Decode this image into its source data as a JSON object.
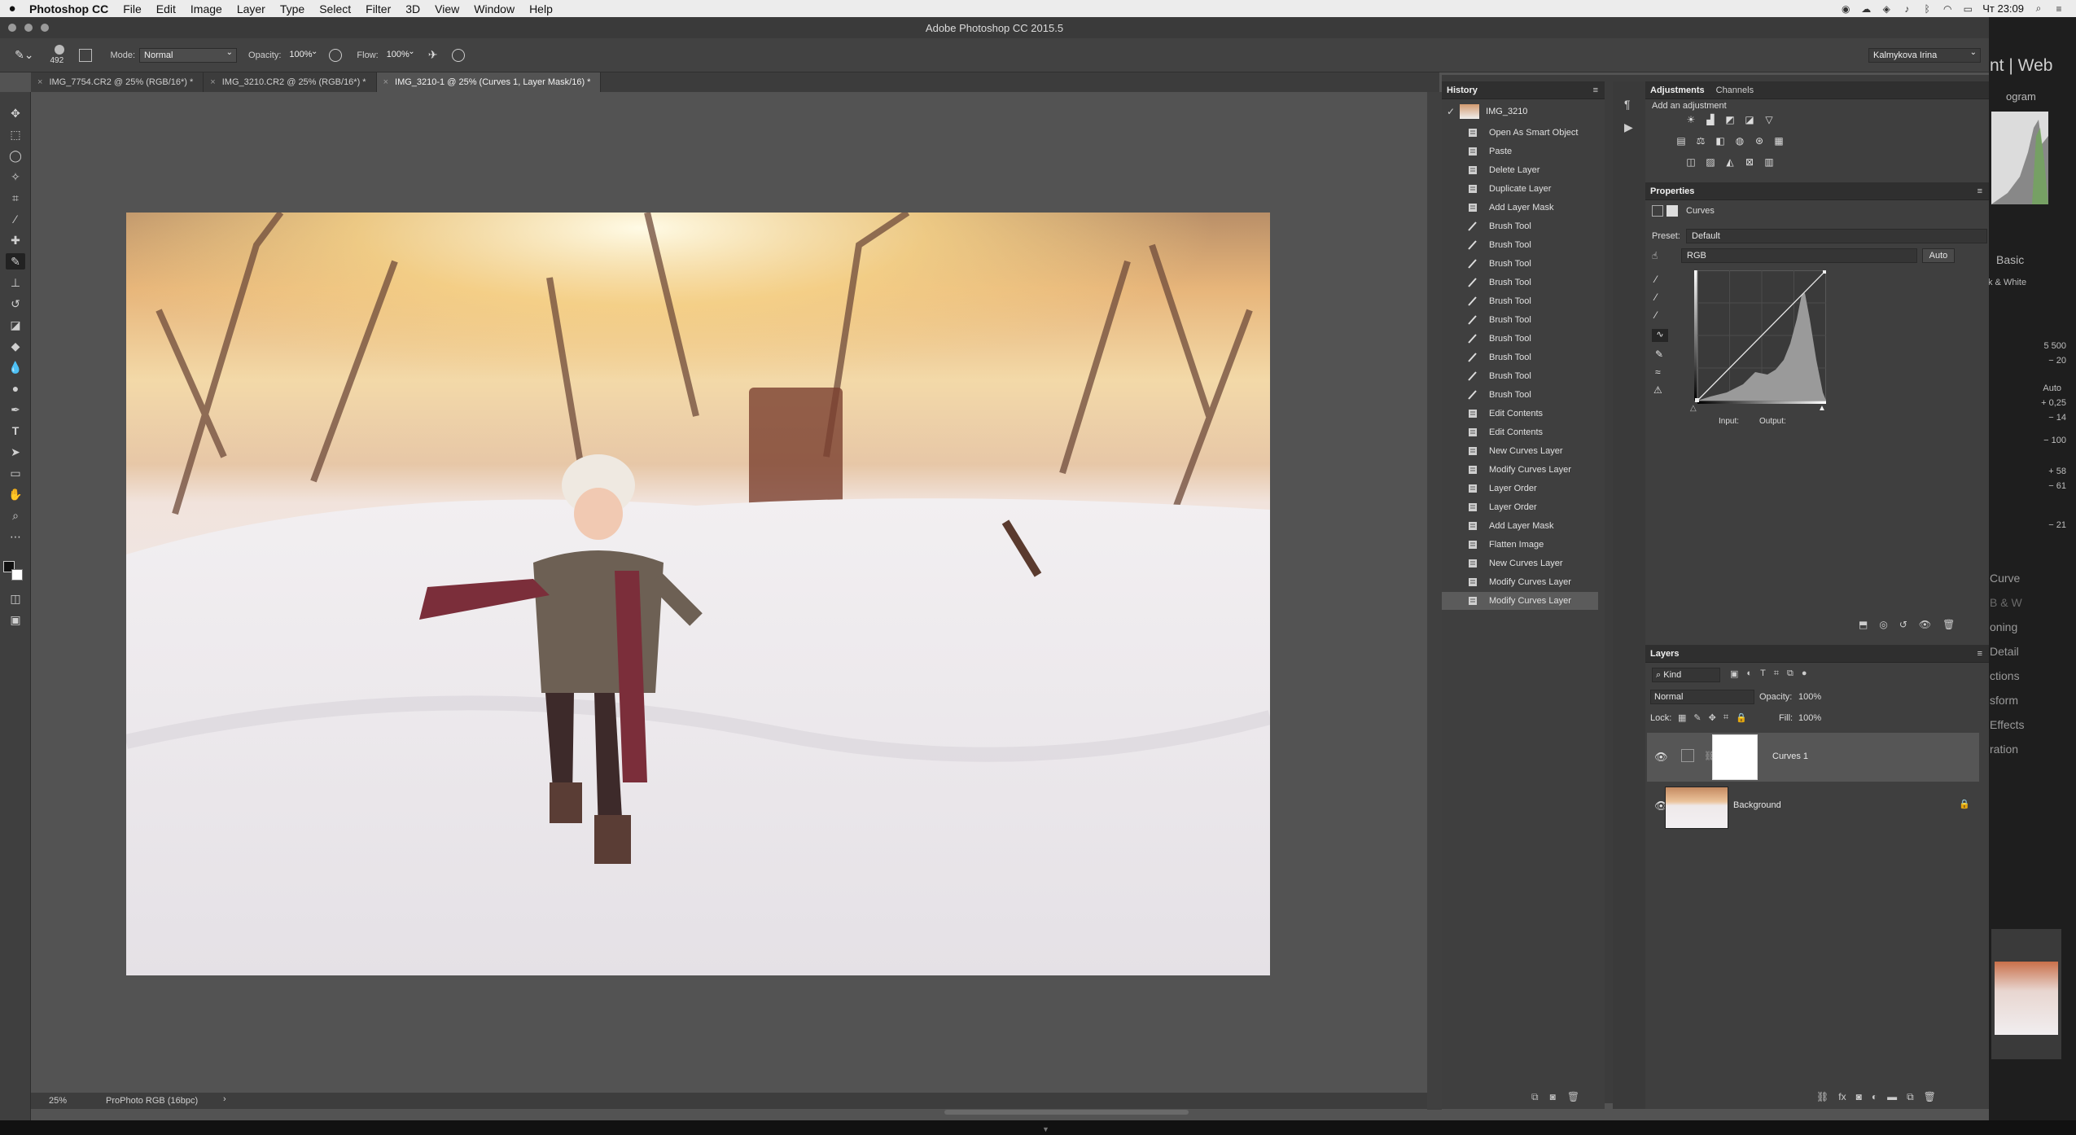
{
  "menubar": {
    "items": [
      "Photoshop CC",
      "File",
      "Edit",
      "Image",
      "Layer",
      "Type",
      "Select",
      "Filter",
      "3D",
      "View",
      "Window",
      "Help"
    ],
    "clock": "Чт 23:09"
  },
  "window": {
    "title": "Adobe Photoshop CC 2015.5"
  },
  "options": {
    "brush_size": "492",
    "mode_label": "Mode:",
    "mode_value": "Normal",
    "opacity_label": "Opacity:",
    "opacity_value": "100%",
    "flow_label": "Flow:",
    "flow_value": "100%",
    "workspace": "Kalmykova Irina"
  },
  "tabs": [
    {
      "label": "IMG_7754.CR2 @ 25% (RGB/16*) *",
      "active": false
    },
    {
      "label": "IMG_3210.CR2 @ 25% (RGB/16*) *",
      "active": false
    },
    {
      "label": "IMG_3210-1 @ 25% (Curves 1, Layer Mask/16) *",
      "active": true
    }
  ],
  "status": {
    "zoom": "25%",
    "profile": "ProPhoto RGB (16bpc)"
  },
  "history": {
    "title": "History",
    "snapshot": "IMG_3210",
    "items": [
      {
        "label": "Open As Smart Object",
        "icon": "doc-icon"
      },
      {
        "label": "Paste",
        "icon": "doc-icon"
      },
      {
        "label": "Delete Layer",
        "icon": "doc-icon"
      },
      {
        "label": "Duplicate Layer",
        "icon": "doc-icon"
      },
      {
        "label": "Add Layer Mask",
        "icon": "doc-icon"
      },
      {
        "label": "Brush Tool",
        "icon": "brush-icon"
      },
      {
        "label": "Brush Tool",
        "icon": "brush-icon"
      },
      {
        "label": "Brush Tool",
        "icon": "brush-icon"
      },
      {
        "label": "Brush Tool",
        "icon": "brush-icon"
      },
      {
        "label": "Brush Tool",
        "icon": "brush-icon"
      },
      {
        "label": "Brush Tool",
        "icon": "brush-icon"
      },
      {
        "label": "Brush Tool",
        "icon": "brush-icon"
      },
      {
        "label": "Brush Tool",
        "icon": "brush-icon"
      },
      {
        "label": "Brush Tool",
        "icon": "brush-icon"
      },
      {
        "label": "Brush Tool",
        "icon": "brush-icon"
      },
      {
        "label": "Edit Contents",
        "icon": "doc-icon"
      },
      {
        "label": "Edit Contents",
        "icon": "doc-icon"
      },
      {
        "label": "New Curves Layer",
        "icon": "doc-icon"
      },
      {
        "label": "Modify Curves Layer",
        "icon": "doc-icon"
      },
      {
        "label": "Layer Order",
        "icon": "doc-icon"
      },
      {
        "label": "Layer Order",
        "icon": "doc-icon"
      },
      {
        "label": "Add Layer Mask",
        "icon": "doc-icon"
      },
      {
        "label": "Flatten Image",
        "icon": "doc-icon"
      },
      {
        "label": "New Curves Layer",
        "icon": "doc-icon"
      },
      {
        "label": "Modify Curves Layer",
        "icon": "doc-icon"
      },
      {
        "label": "Modify Curves Layer",
        "icon": "doc-icon",
        "selected": true
      }
    ]
  },
  "adjustments": {
    "tab1": "Adjustments",
    "tab2": "Channels",
    "hint": "Add an adjustment"
  },
  "properties": {
    "title": "Properties",
    "type": "Curves",
    "preset_label": "Preset:",
    "preset_value": "Default",
    "channel": "RGB",
    "auto": "Auto",
    "input_label": "Input:",
    "output_label": "Output:"
  },
  "layers": {
    "title": "Layers",
    "kind": "Kind",
    "blend": "Normal",
    "opacity_label": "Opacity:",
    "opacity_value": "100%",
    "lock_label": "Lock:",
    "fill_label": "Fill:",
    "fill_value": "100%",
    "items": [
      {
        "name": "Curves 1",
        "selected": true
      },
      {
        "name": "Background",
        "selected": false
      }
    ]
  },
  "lightroom": {
    "top_text": "nt | Web",
    "histogram": "ogram",
    "basic": "Basic",
    "bw": "k & White",
    "auto": "Auto",
    "values": [
      "− 20",
      "+ 0,25",
      "− 14",
      "− 100",
      "+ 58",
      "− 61",
      "− 21"
    ],
    "temp": "5 500",
    "panels": [
      "Curve",
      "B & W",
      "oning",
      "Detail",
      "ctions",
      "sform",
      "Effects",
      "ration"
    ]
  }
}
